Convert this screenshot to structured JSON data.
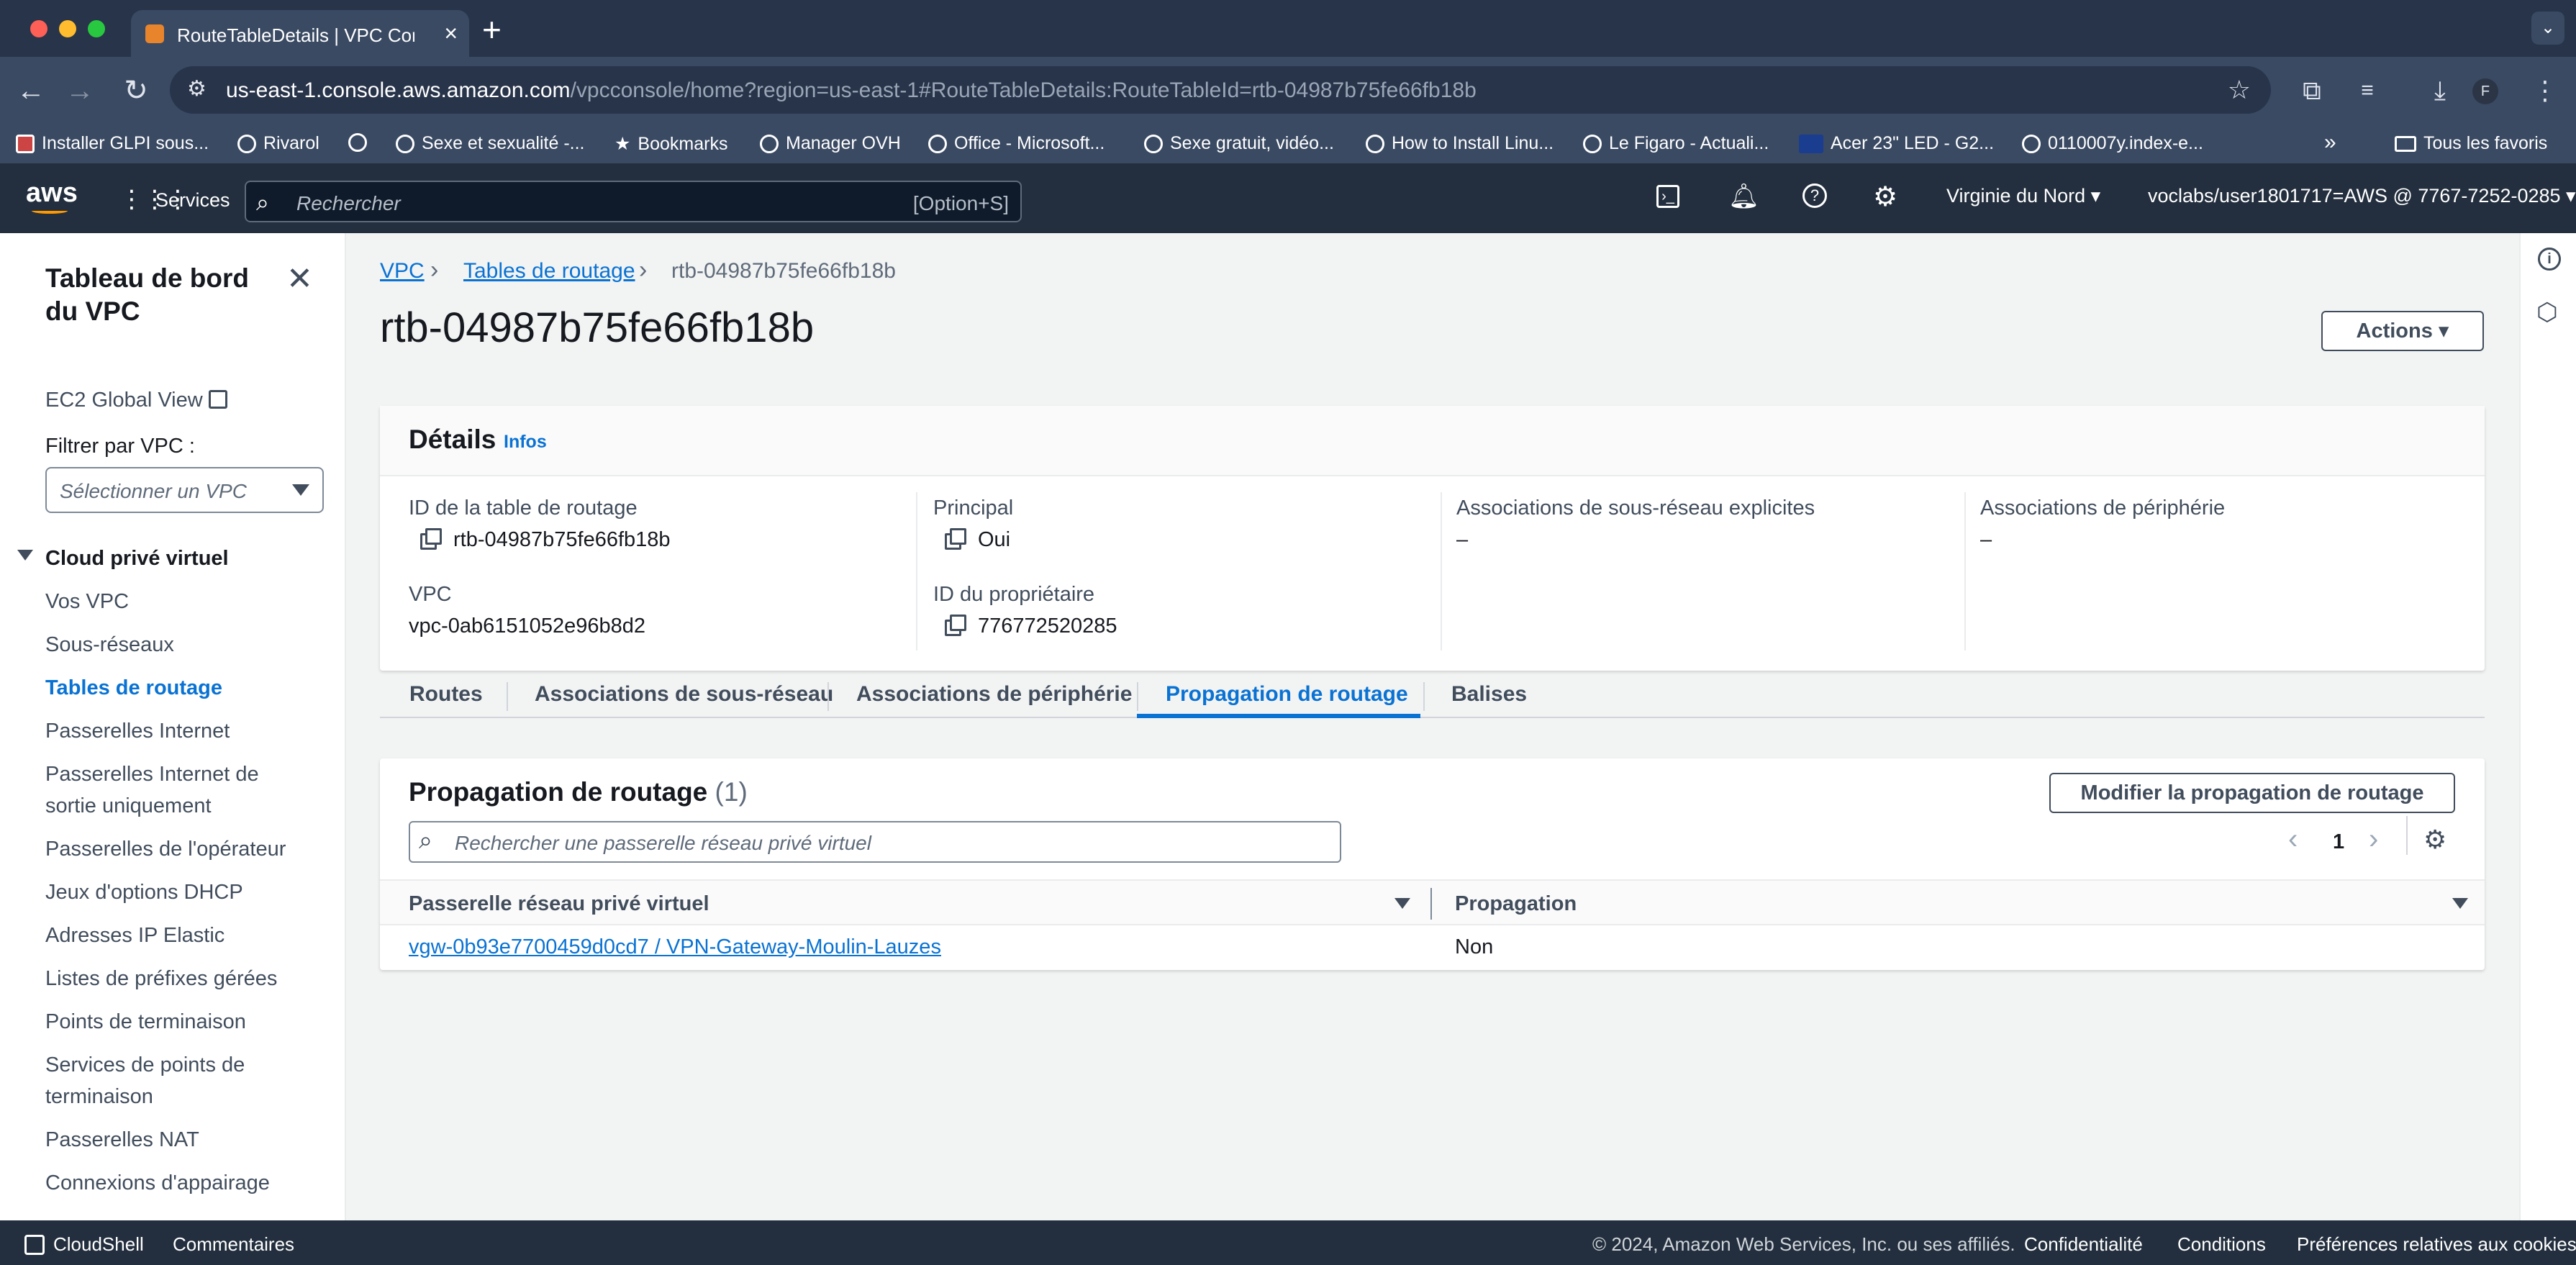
{
  "browser": {
    "tab_title": "RouteTableDetails | VPC Console",
    "url_host": "us-east-1.console.aws.amazon.com",
    "url_path": "/vpcconsole/home?region=us-east-1#RouteTableDetails:RouteTableId=rtb-04987b75fe66fb18b",
    "profile_initial": "F",
    "bookmarks": [
      "Installer GLPI sous...",
      "Rivarol",
      "Sexe et sexualité -...",
      "Bookmarks",
      "Manager OVH",
      "Office - Microsoft...",
      "Sexe gratuit, vidéo...",
      "How to Install Linu...",
      "Le Figaro - Actuali...",
      "Acer 23\" LED - G2...",
      "0110007y.index-e..."
    ],
    "all_bookmarks": "Tous les favoris"
  },
  "aws": {
    "logo": "aws",
    "services": "Services",
    "search_placeholder": "Rechercher",
    "search_shortcut": "[Option+S]",
    "region": "Virginie du Nord",
    "account": "voclabs/user1801717=AWS @ 7767-7252-0285"
  },
  "sidebar": {
    "title": "Tableau de bord du VPC",
    "global_view": "EC2 Global View",
    "filter_label": "Filtrer par VPC :",
    "filter_placeholder": "Sélectionner un VPC",
    "section": "Cloud privé virtuel",
    "items": [
      "Vos VPC",
      "Sous-réseaux",
      "Tables de routage",
      "Passerelles Internet",
      "Passerelles Internet de sortie uniquement",
      "Passerelles de l'opérateur",
      "Jeux d'options DHCP",
      "Adresses IP Elastic",
      "Listes de préfixes gérées",
      "Points de terminaison",
      "Services de points de terminaison",
      "Passerelles NAT",
      "Connexions d'appairage"
    ]
  },
  "breadcrumb": [
    "VPC",
    "Tables de routage",
    "rtb-04987b75fe66fb18b"
  ],
  "page_title": "rtb-04987b75fe66fb18b",
  "actions_label": "Actions",
  "details": {
    "heading": "Détails",
    "info": "Infos",
    "route_table_id_label": "ID de la table de routage",
    "route_table_id": "rtb-04987b75fe66fb18b",
    "main_label": "Principal",
    "main_value": "Oui",
    "subnet_assoc_label": "Associations de sous-réseau explicites",
    "subnet_assoc_value": "–",
    "edge_assoc_label": "Associations de périphérie",
    "edge_assoc_value": "–",
    "vpc_label": "VPC",
    "vpc_value": "vpc-0ab6151052e96b8d2",
    "owner_label": "ID du propriétaire",
    "owner_value": "776772520285"
  },
  "tabs": [
    "Routes",
    "Associations de sous-réseau",
    "Associations de périphérie",
    "Propagation de routage",
    "Balises"
  ],
  "propagation": {
    "heading": "Propagation de routage",
    "count": "(1)",
    "edit_button": "Modifier la propagation de routage",
    "search_placeholder": "Rechercher une passerelle réseau privé virtuel",
    "page": "1",
    "col_gateway": "Passerelle réseau privé virtuel",
    "col_propagation": "Propagation",
    "rows": [
      {
        "gateway": "vgw-0b93e7700459d0cd7 / VPN-Gateway-Moulin-Lauzes",
        "propagation": "Non"
      }
    ]
  },
  "footer": {
    "cloudshell": "CloudShell",
    "feedback": "Commentaires",
    "copyright": "© 2024, Amazon Web Services, Inc. ou ses affiliés.",
    "privacy": "Confidentialité",
    "terms": "Conditions",
    "cookies": "Préférences relatives aux cookies"
  }
}
